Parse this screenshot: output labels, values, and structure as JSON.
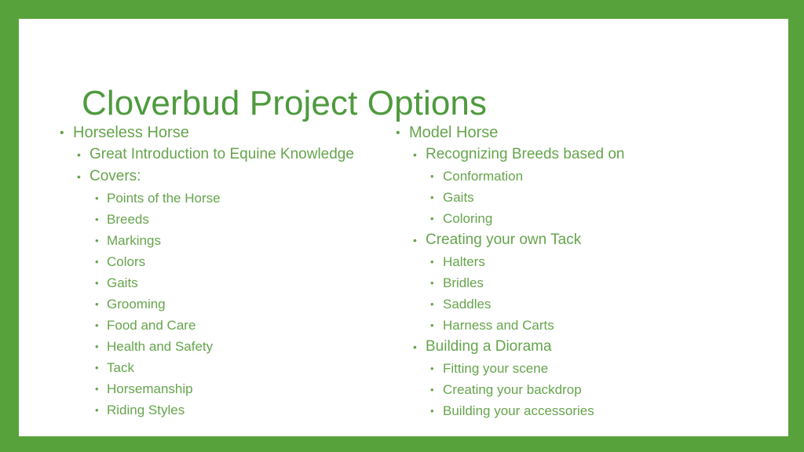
{
  "slide": {
    "title": "Cloverbud Project Options",
    "frame_color": "#57a23a",
    "background_color": "#ffffff",
    "title_color": "#4e9a3e",
    "body_color": "#66a44d",
    "bullet_glyph": "•"
  },
  "columns": {
    "left": {
      "heading": "Horseless Horse",
      "sub": [
        {
          "text": "Great Introduction to Equine Knowledge"
        },
        {
          "text": "Covers:"
        }
      ],
      "details": [
        "Points of the Horse",
        "Breeds",
        "Markings",
        "Colors",
        "Gaits",
        "Grooming",
        "Food and Care",
        "Health and Safety",
        "Tack",
        "Horsemanship",
        "Riding Styles"
      ]
    },
    "right": {
      "heading": "Model Horse",
      "groups": [
        {
          "label": "Recognizing Breeds based on",
          "items": [
            "Conformation",
            "Gaits",
            "Coloring"
          ]
        },
        {
          "label": "Creating your own Tack",
          "items": [
            "Halters",
            "Bridles",
            "Saddles",
            "Harness and Carts"
          ]
        },
        {
          "label": "Building a Diorama",
          "items": [
            "Fitting your scene",
            "Creating your backdrop",
            "Building your accessories"
          ]
        }
      ]
    }
  }
}
